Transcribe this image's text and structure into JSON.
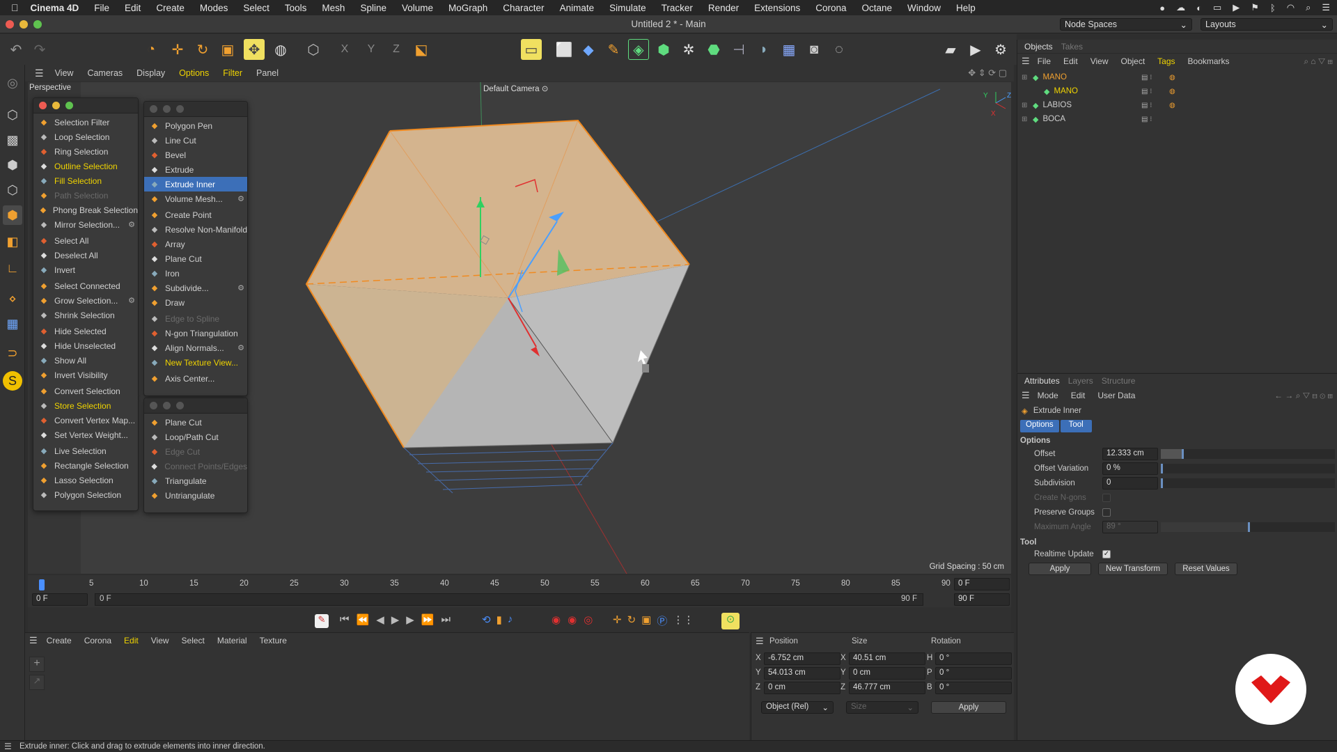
{
  "macbar": {
    "items": [
      "Cinema 4D",
      "File",
      "Edit",
      "Create",
      "Modes",
      "Select",
      "Tools",
      "Mesh",
      "Spline",
      "Volume",
      "MoGraph",
      "Character",
      "Animate",
      "Simulate",
      "Tracker",
      "Render",
      "Extensions",
      "Corona",
      "Octane",
      "Window",
      "Help"
    ]
  },
  "window": {
    "title": "Untitled 2 * - Main",
    "node_spaces": "Node Spaces",
    "layouts": "Layouts"
  },
  "viewport": {
    "menu": [
      "View",
      "Cameras",
      "Display",
      "Options",
      "Filter",
      "Panel"
    ],
    "label": "Perspective",
    "camera": "Default Camera",
    "grid_spacing": "Grid Spacing : 50 cm",
    "axis_y": "Y",
    "axis_z": "Z",
    "axis_x": "X"
  },
  "select_menu": {
    "items": [
      {
        "label": "Selection Filter",
        "style": "normal",
        "icon": "filter-icon",
        "gear": false,
        "arrow": true
      },
      {
        "label": "Loop Selection",
        "style": "normal",
        "icon": "loop-icon"
      },
      {
        "label": "Ring Selection",
        "style": "normal",
        "icon": "ring-icon"
      },
      {
        "label": "Outline Selection",
        "style": "hl",
        "icon": "outline-icon"
      },
      {
        "label": "Fill Selection",
        "style": "hl",
        "icon": "fill-icon"
      },
      {
        "label": "Path Selection",
        "style": "dim",
        "icon": "path-icon"
      },
      {
        "label": "Phong Break Selection",
        "style": "normal",
        "icon": "phong-icon"
      },
      {
        "label": "Mirror Selection...",
        "style": "normal",
        "icon": "mirror-icon",
        "gear": true
      },
      {
        "label": "Select All",
        "style": "normal",
        "icon": "select-all-icon",
        "sepBefore": true
      },
      {
        "label": "Deselect All",
        "style": "normal",
        "icon": "deselect-icon"
      },
      {
        "label": "Invert",
        "style": "normal",
        "icon": "invert-icon"
      },
      {
        "label": "Select Connected",
        "style": "normal",
        "icon": "connected-icon",
        "sepBefore": true
      },
      {
        "label": "Grow Selection...",
        "style": "normal",
        "icon": "grow-icon",
        "gear": true
      },
      {
        "label": "Shrink Selection",
        "style": "normal",
        "icon": "shrink-icon"
      },
      {
        "label": "Hide Selected",
        "style": "normal",
        "icon": "hide-icon",
        "sepBefore": true
      },
      {
        "label": "Hide Unselected",
        "style": "normal",
        "icon": "hide-unsel-icon"
      },
      {
        "label": "Show All",
        "style": "normal",
        "icon": "show-icon"
      },
      {
        "label": "Invert Visibility",
        "style": "normal",
        "icon": "invert-vis-icon"
      },
      {
        "label": "Convert Selection",
        "style": "normal",
        "icon": "convert-icon",
        "sepBefore": true
      },
      {
        "label": "Store Selection",
        "style": "hl",
        "icon": "store-icon"
      },
      {
        "label": "Convert Vertex Map...",
        "style": "normal",
        "icon": "vertex-map-icon"
      },
      {
        "label": "Set Vertex Weight...",
        "style": "normal",
        "icon": "vertex-weight-icon"
      },
      {
        "label": "Live Selection",
        "style": "normal",
        "icon": "live-icon",
        "sepBefore": true
      },
      {
        "label": "Rectangle Selection",
        "style": "normal",
        "icon": "rect-icon"
      },
      {
        "label": "Lasso Selection",
        "style": "normal",
        "icon": "lasso-icon"
      },
      {
        "label": "Polygon Selection",
        "style": "normal",
        "icon": "poly-sel-icon"
      }
    ]
  },
  "mesh_menu": {
    "items": [
      {
        "label": "Polygon Pen",
        "style": "normal",
        "icon": "pen-icon"
      },
      {
        "label": "Line Cut",
        "style": "normal",
        "icon": "line-cut-icon"
      },
      {
        "label": "Bevel",
        "style": "normal",
        "icon": "bevel-icon"
      },
      {
        "label": "Extrude",
        "style": "normal",
        "icon": "extrude-icon"
      },
      {
        "label": "Extrude Inner",
        "style": "sel",
        "icon": "extrude-inner-icon"
      },
      {
        "label": "Volume Mesh...",
        "style": "normal",
        "icon": "volume-icon",
        "gear": true
      },
      {
        "label": "Create Point",
        "style": "normal",
        "icon": "point-icon",
        "sepBefore": true
      },
      {
        "label": "Resolve Non-Manifold",
        "style": "normal",
        "icon": "manifold-icon"
      },
      {
        "label": "Array",
        "style": "normal",
        "icon": "array-icon"
      },
      {
        "label": "Plane Cut",
        "style": "normal",
        "icon": "plane-cut-icon"
      },
      {
        "label": "Iron",
        "style": "normal",
        "icon": "iron-icon"
      },
      {
        "label": "Subdivide...",
        "style": "normal",
        "icon": "subdivide-icon",
        "gear": true
      },
      {
        "label": "Draw",
        "style": "normal",
        "icon": "draw-icon"
      },
      {
        "label": "Edge to Spline",
        "style": "dim",
        "icon": "edge-spline-icon",
        "sepBefore": true
      },
      {
        "label": "N-gon Triangulation",
        "style": "normal",
        "icon": "ngon-icon"
      },
      {
        "label": "Align Normals...",
        "style": "normal",
        "icon": "normals-icon",
        "gear": true
      },
      {
        "label": "New Texture View...",
        "style": "hl",
        "icon": "texture-view-icon"
      },
      {
        "label": "Axis Center...",
        "style": "normal",
        "icon": "axis-center-icon",
        "sepBefore": true
      }
    ]
  },
  "cut_menu": {
    "items": [
      {
        "label": "Plane Cut",
        "style": "normal",
        "icon": "plane-cut-icon"
      },
      {
        "label": "Loop/Path Cut",
        "style": "normal",
        "icon": "loop-cut-icon"
      },
      {
        "label": "Edge Cut",
        "style": "dim",
        "icon": "edge-cut-icon"
      },
      {
        "label": "Connect Points/Edges",
        "style": "dim",
        "icon": "connect-icon"
      },
      {
        "label": "Triangulate",
        "style": "normal",
        "icon": "triangulate-icon"
      },
      {
        "label": "Untriangulate",
        "style": "normal",
        "icon": "untriangulate-icon"
      }
    ]
  },
  "timeline": {
    "ticks": [
      "0",
      "5",
      "10",
      "15",
      "20",
      "25",
      "30",
      "35",
      "40",
      "45",
      "50",
      "55",
      "60",
      "65",
      "70",
      "75",
      "80",
      "85",
      "90"
    ],
    "current": "0 F",
    "start": "0 F",
    "start2": "0 F",
    "end": "90 F",
    "end2": "90 F"
  },
  "material_manager": {
    "menu": [
      "Create",
      "Corona",
      "Edit",
      "View",
      "Select",
      "Material",
      "Texture"
    ],
    "active": "Edit"
  },
  "coordinates": {
    "headers": [
      "Position",
      "Size",
      "Rotation"
    ],
    "rows": [
      {
        "axis": "X",
        "pos": "-6.752 cm",
        "saxis": "X",
        "size": "40.51 cm",
        "raxis": "H",
        "rot": "0 °"
      },
      {
        "axis": "Y",
        "pos": "54.013 cm",
        "saxis": "Y",
        "size": "0 cm",
        "raxis": "P",
        "rot": "0 °"
      },
      {
        "axis": "Z",
        "pos": "0 cm",
        "saxis": "Z",
        "size": "46.777 cm",
        "raxis": "B",
        "rot": "0 °"
      }
    ],
    "mode": "Object (Rel)",
    "size_mode": "Size",
    "apply": "Apply"
  },
  "objects": {
    "tabs": [
      "Objects",
      "Takes"
    ],
    "menu": [
      "File",
      "Edit",
      "View",
      "Object",
      "Tags",
      "Bookmarks"
    ],
    "active_menu": "Tags",
    "rows": [
      {
        "name": "MANO",
        "color": "#f0a030",
        "indent": 0
      },
      {
        "name": "MANO",
        "color": "#f0d400",
        "indent": 1
      },
      {
        "name": "LABIOS",
        "color": "#cfcfcf",
        "indent": 0
      },
      {
        "name": "BOCA",
        "color": "#cfcfcf",
        "indent": 0
      }
    ]
  },
  "attributes": {
    "tabs": [
      "Attributes",
      "Layers",
      "Structure"
    ],
    "menu": [
      "Mode",
      "Edit",
      "User Data"
    ],
    "tool_name": "Extrude Inner",
    "subtabs": [
      "Options",
      "Tool"
    ],
    "options_title": "Options",
    "fields": [
      {
        "label": "Offset",
        "value": "12.333 cm",
        "dim": false,
        "fill": 0.12
      },
      {
        "label": "Offset Variation",
        "value": "0 %",
        "dim": false,
        "fill": 0
      },
      {
        "label": "Subdivision",
        "value": "0",
        "dim": false,
        "fill": 0
      },
      {
        "label": "Maximum Angle",
        "value": "89 °",
        "dim": true,
        "fill": 0.5
      }
    ],
    "create_ngons": "Create N-gons",
    "preserve_groups": "Preserve Groups",
    "tool_title": "Tool",
    "realtime_update": "Realtime Update",
    "buttons": [
      "Apply",
      "New Transform",
      "Reset Values"
    ]
  },
  "status": "Extrude inner: Click and drag to extrude elements into inner direction."
}
